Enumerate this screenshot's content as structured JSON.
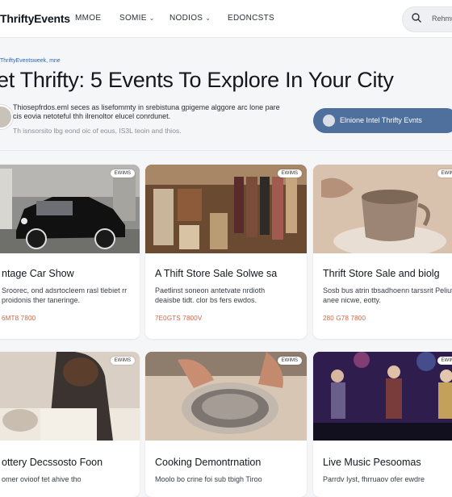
{
  "header": {
    "brand": "ThriftyEvents",
    "nav": [
      {
        "label": "MMOE",
        "dropdown": false
      },
      {
        "label": "SOMIE",
        "dropdown": true
      },
      {
        "label": "NODIOS",
        "dropdown": true
      },
      {
        "label": "EDONCSTS",
        "dropdown": false
      }
    ],
    "search": {
      "label": "Rehmu"
    }
  },
  "article": {
    "breadcrumb": "ThriftyEventsweek, mne",
    "title": "et Thrifty: 5 Events To Explore In Your City",
    "description": "Thiosepfrdos.eml seces as lisefommty in srebistuna gpigeme alggore arc lone pare cis eovia netoteful thh ilrenoltor elucel conrdunet.",
    "meta": "Th isnsorsito lbg eond oic of eous, IS3L teoin and thios.",
    "cta_label": "Elnione Intel Thrifty Evnts"
  },
  "cards": [
    {
      "title": "ntage Car Show",
      "description": "Sroorec, ond adsrtocleem rasl tlebiet rr proidonis ther taneringe.",
      "date": "6MT8 7800",
      "badge": "EWIMS",
      "image": "vintage-car"
    },
    {
      "title": "A Thift Store Sale Solwe sa",
      "description": "Paetlinst soneon antetvate nrdioth deaisbe tidt. clor bs fers ewdos.",
      "date": "7E0GTS 7800V",
      "badge": "EWIMS",
      "image": "thrift-store"
    },
    {
      "title": "Thrift Store Sale and biolg",
      "description": "Sosb bus atrin tbsadhoenn tarssrit Peliut anee nicwe, eotty.",
      "date": "280 G78 7800",
      "badge": "EWIMS",
      "image": "pottery-cup"
    },
    {
      "title": "ottery Decssosto Foon",
      "description": "omer ovioof tet ahive tho",
      "image": "pottery-maker",
      "badge": "EWIMS"
    },
    {
      "title": "Cooking Demontrnation",
      "description": "Moolo bo crine foi sub tbigh Tiroo",
      "image": "cooking",
      "badge": "EWIMS"
    },
    {
      "title": "Live Music Pesoomas",
      "description": "Parrdv Iyst, fhrruaov ofer ewdre",
      "image": "live-music",
      "badge": "EWIMS"
    }
  ],
  "colors": {
    "accent": "#4f6f9d",
    "date": "#d9603f",
    "link": "#2e63b8"
  }
}
